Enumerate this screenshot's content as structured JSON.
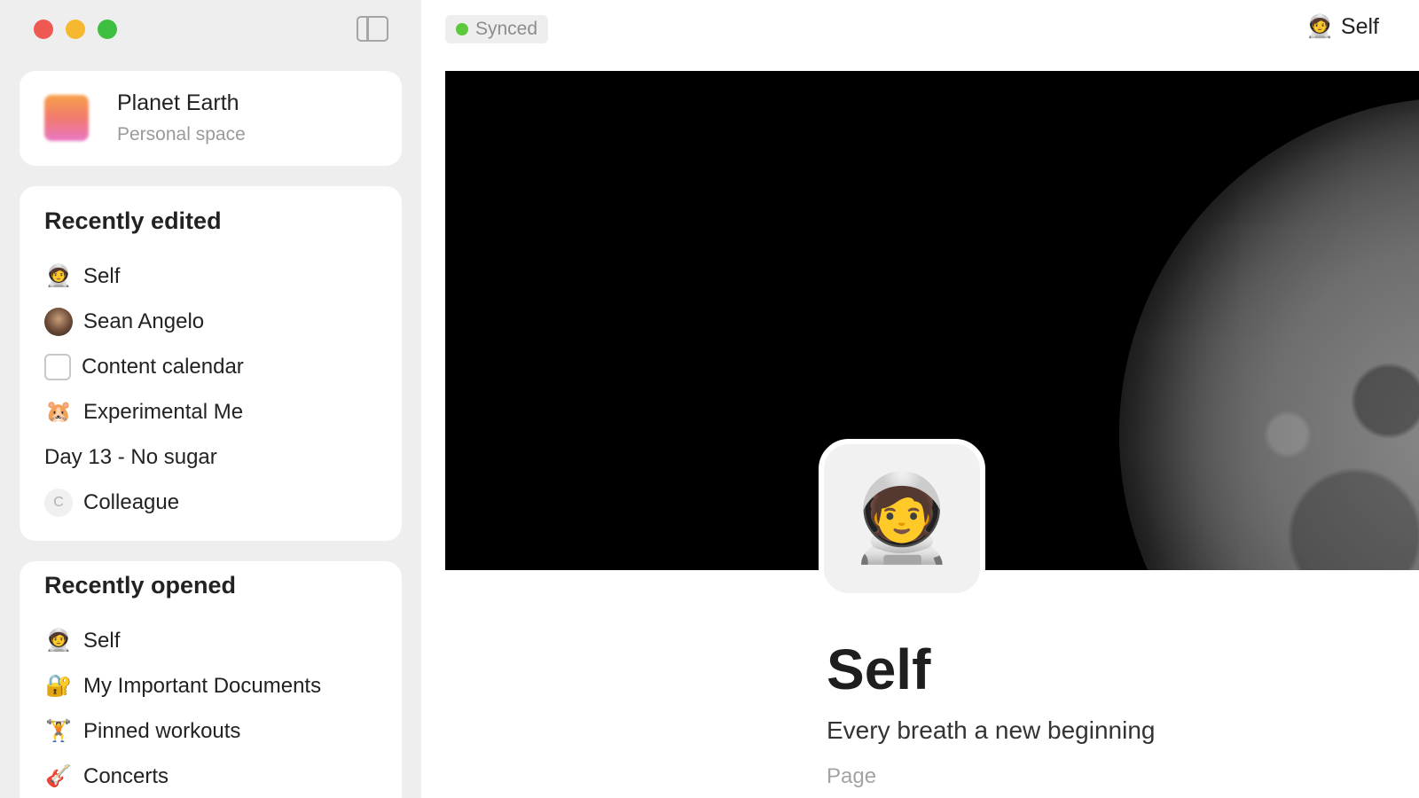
{
  "sidebar": {
    "space": {
      "name": "Planet Earth",
      "subtitle": "Personal space"
    },
    "recently_edited": {
      "heading": "Recently edited",
      "items": [
        {
          "icon": "🧑‍🚀",
          "label": "Self"
        },
        {
          "icon": "",
          "label": "Sean Angelo"
        },
        {
          "icon": "",
          "label": "Content calendar"
        },
        {
          "icon": "🐹",
          "label": "Experimental Me"
        },
        {
          "icon": "",
          "label": "Day 13 - No sugar"
        },
        {
          "icon": "C",
          "label": "Colleague"
        }
      ]
    },
    "recently_opened": {
      "heading": "Recently opened",
      "items": [
        {
          "icon": "🧑‍🚀",
          "label": "Self"
        },
        {
          "icon": "🔐",
          "label": "My Important Documents"
        },
        {
          "icon": "🏋️",
          "label": "Pinned workouts"
        },
        {
          "icon": "🎸",
          "label": "Concerts"
        }
      ]
    }
  },
  "header": {
    "sync_status": "Synced",
    "current_page_icon": "🧑‍🚀",
    "current_page": "Self"
  },
  "page": {
    "icon": "🧑‍🚀",
    "title": "Self",
    "subtitle": "Every breath a new beginning",
    "type": "Page"
  },
  "colors": {
    "sidebar_bg": "#eeeeee",
    "synced_dot": "#5cc93b",
    "traffic_red": "#ee5a52",
    "traffic_yellow": "#f5b82e",
    "traffic_green": "#3fbf3f"
  }
}
